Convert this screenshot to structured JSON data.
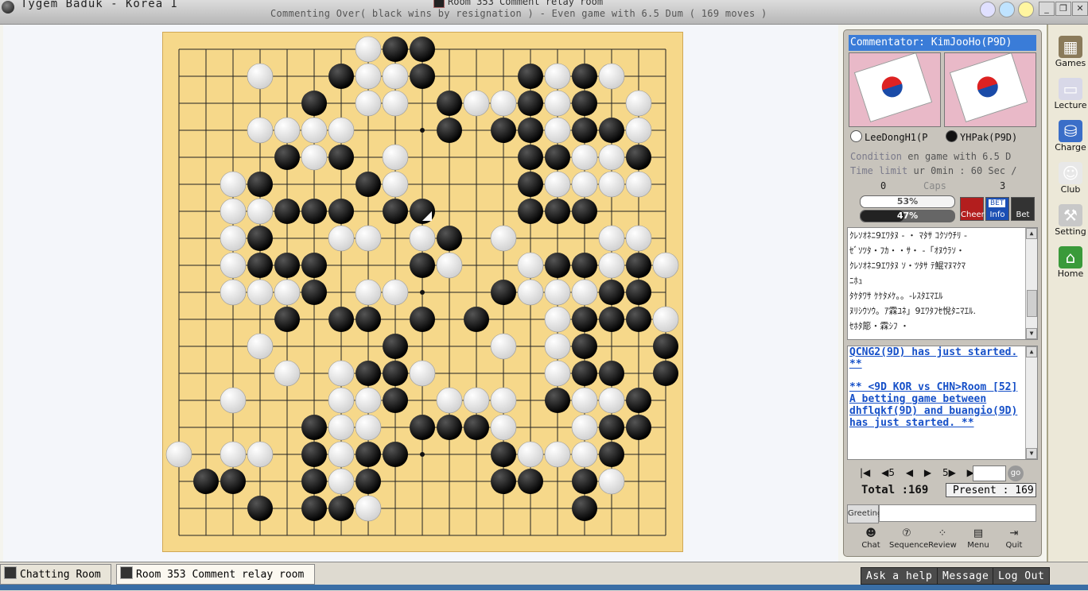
{
  "window": {
    "app_title": "Tygem Baduk - Korea I",
    "room_title": "Room 353 Comment relay room",
    "status": "Commenting Over( black wins by resignation ) - Even game with 6.5 Dum  ( 169 moves )"
  },
  "panel": {
    "commentator": "Commentator: KimJooHo(P9D)",
    "white_player": "LeeDongH1(P",
    "black_player": "YHPak(P9D)",
    "condition_label": "Condition",
    "condition_value": "en game with 6.5 D",
    "time_label": "Time limit",
    "time_value": "ur 0min : 60 Sec /",
    "caps_label": "Caps",
    "caps_white": "0",
    "caps_black": "3",
    "white_pct_label": "53%",
    "black_pct_label": "47%",
    "white_pct": 0.53,
    "black_pct": 0.47,
    "cheer_label": "Cheer",
    "info_label": "Info",
    "bet_label": "Bet",
    "info_badge": "BET",
    "chat_lines": [
      "ｸﾚｿｵﾈﾆ9ｴﾜﾀﾇ - ・ ﾏﾀｻ ｺｸｿｳﾁﾘ -",
      "ｾﾞｿﾂﾀ・ﾌｶ・・ｻ・ -「ｵﾇｳﾗｿ・",
      "ｸﾚｿｵﾈﾆ9ｴﾜﾀﾇ ｿ・ﾂﾀｻ ﾃ鯤ﾏﾇﾏｸﾏ",
      "ﾆﾎｭ",
      "ﾀｹﾀﾜｻ ｹｹﾀﾒｹ｡。-ﾚｽﾀｴﾏｴﾙ",
      "ﾇﾘｼｳｿｳ。ｱ霖ﾕﾈ」9ｴﾜﾀﾌｾ悅ﾀﾆﾏｴﾙ.",
      "ｾﾎﾀ簓・霖ｼﾌ ・"
    ],
    "notices": [
      "QCNG2(9D) has just started. **",
      "** <9D KOR vs CHN>Room [52] A betting game between dhflqkf(9D) and buangio(9D) has just started. **"
    ],
    "nav_labels": [
      "|◀",
      "◀5",
      "◀",
      "▶",
      "5▶",
      "▶|"
    ],
    "go_label": "go",
    "total_text": "Total :169",
    "present_text": "Present : 169",
    "greeting_label": "Greeting",
    "tools": [
      {
        "label": "Chat",
        "icon": "chat-icon",
        "glyph": "☻"
      },
      {
        "label": "Sequence",
        "icon": "sequence-icon",
        "glyph": "⑦"
      },
      {
        "label": "Review",
        "icon": "review-icon",
        "glyph": "⁘"
      },
      {
        "label": "Menu",
        "icon": "menu-icon",
        "glyph": "▤"
      },
      {
        "label": "Quit",
        "icon": "quit-icon",
        "glyph": "⇥"
      }
    ]
  },
  "sidebar": [
    {
      "label": "Games",
      "icon": "games-icon",
      "glyph": "▦"
    },
    {
      "label": "Lecture",
      "icon": "lecture-icon",
      "glyph": "▭"
    },
    {
      "label": "Charge",
      "icon": "charge-icon",
      "glyph": "⛁"
    },
    {
      "label": "Club",
      "icon": "club-icon",
      "glyph": "☺"
    },
    {
      "label": "Setting",
      "icon": "setting-icon",
      "glyph": "⚒"
    },
    {
      "label": "Home",
      "icon": "home-icon",
      "glyph": "⌂"
    }
  ],
  "bottom": {
    "tab_chat": "Chatting Room",
    "tab_room": "Room 353 Comment relay room",
    "ask_help": "Ask a help",
    "message": "Message",
    "logout": "Log Out"
  },
  "colors": {
    "board": "#f6d88a",
    "panel_header": "#3a7cd8",
    "notice": "#1650c8"
  },
  "board": {
    "size": 19,
    "last_move": [
      9,
      6
    ],
    "black": [
      [
        8,
        0
      ],
      [
        9,
        0
      ],
      [
        6,
        1
      ],
      [
        9,
        1
      ],
      [
        13,
        1
      ],
      [
        15,
        1
      ],
      [
        5,
        2
      ],
      [
        10,
        2
      ],
      [
        13,
        2
      ],
      [
        15,
        2
      ],
      [
        10,
        3
      ],
      [
        12,
        3
      ],
      [
        13,
        3
      ],
      [
        15,
        3
      ],
      [
        16,
        3
      ],
      [
        4,
        4
      ],
      [
        6,
        4
      ],
      [
        13,
        4
      ],
      [
        14,
        4
      ],
      [
        17,
        4
      ],
      [
        3,
        5
      ],
      [
        7,
        5
      ],
      [
        13,
        5
      ],
      [
        4,
        6
      ],
      [
        5,
        6
      ],
      [
        6,
        6
      ],
      [
        8,
        6
      ],
      [
        9,
        6
      ],
      [
        13,
        6
      ],
      [
        14,
        6
      ],
      [
        15,
        6
      ],
      [
        3,
        7
      ],
      [
        10,
        7
      ],
      [
        3,
        8
      ],
      [
        4,
        8
      ],
      [
        5,
        8
      ],
      [
        9,
        8
      ],
      [
        14,
        8
      ],
      [
        15,
        8
      ],
      [
        17,
        8
      ],
      [
        5,
        9
      ],
      [
        12,
        9
      ],
      [
        16,
        9
      ],
      [
        17,
        9
      ],
      [
        4,
        10
      ],
      [
        6,
        10
      ],
      [
        7,
        10
      ],
      [
        9,
        10
      ],
      [
        11,
        10
      ],
      [
        15,
        10
      ],
      [
        16,
        10
      ],
      [
        17,
        10
      ],
      [
        8,
        11
      ],
      [
        15,
        11
      ],
      [
        18,
        11
      ],
      [
        7,
        12
      ],
      [
        8,
        12
      ],
      [
        15,
        12
      ],
      [
        16,
        12
      ],
      [
        18,
        12
      ],
      [
        8,
        13
      ],
      [
        14,
        13
      ],
      [
        17,
        13
      ],
      [
        5,
        14
      ],
      [
        9,
        14
      ],
      [
        10,
        14
      ],
      [
        11,
        14
      ],
      [
        16,
        14
      ],
      [
        17,
        14
      ],
      [
        5,
        15
      ],
      [
        7,
        15
      ],
      [
        8,
        15
      ],
      [
        12,
        15
      ],
      [
        16,
        15
      ],
      [
        1,
        16
      ],
      [
        2,
        16
      ],
      [
        5,
        16
      ],
      [
        7,
        16
      ],
      [
        12,
        16
      ],
      [
        13,
        16
      ],
      [
        15,
        16
      ],
      [
        3,
        17
      ],
      [
        5,
        17
      ],
      [
        6,
        17
      ],
      [
        15,
        17
      ]
    ],
    "white": [
      [
        7,
        0
      ],
      [
        3,
        1
      ],
      [
        7,
        1
      ],
      [
        8,
        1
      ],
      [
        14,
        1
      ],
      [
        16,
        1
      ],
      [
        7,
        2
      ],
      [
        8,
        2
      ],
      [
        11,
        2
      ],
      [
        12,
        2
      ],
      [
        14,
        2
      ],
      [
        17,
        2
      ],
      [
        3,
        3
      ],
      [
        4,
        3
      ],
      [
        5,
        3
      ],
      [
        6,
        3
      ],
      [
        14,
        3
      ],
      [
        17,
        3
      ],
      [
        5,
        4
      ],
      [
        8,
        4
      ],
      [
        15,
        4
      ],
      [
        16,
        4
      ],
      [
        2,
        5
      ],
      [
        8,
        5
      ],
      [
        14,
        5
      ],
      [
        15,
        5
      ],
      [
        16,
        5
      ],
      [
        17,
        5
      ],
      [
        2,
        6
      ],
      [
        3,
        6
      ],
      [
        2,
        7
      ],
      [
        6,
        7
      ],
      [
        7,
        7
      ],
      [
        9,
        7
      ],
      [
        12,
        7
      ],
      [
        16,
        7
      ],
      [
        17,
        7
      ],
      [
        2,
        8
      ],
      [
        10,
        8
      ],
      [
        13,
        8
      ],
      [
        16,
        8
      ],
      [
        18,
        8
      ],
      [
        2,
        9
      ],
      [
        3,
        9
      ],
      [
        4,
        9
      ],
      [
        7,
        9
      ],
      [
        8,
        9
      ],
      [
        13,
        9
      ],
      [
        14,
        9
      ],
      [
        15,
        9
      ],
      [
        14,
        10
      ],
      [
        18,
        10
      ],
      [
        3,
        11
      ],
      [
        12,
        11
      ],
      [
        14,
        11
      ],
      [
        4,
        12
      ],
      [
        6,
        12
      ],
      [
        9,
        12
      ],
      [
        14,
        12
      ],
      [
        2,
        13
      ],
      [
        6,
        13
      ],
      [
        7,
        13
      ],
      [
        10,
        13
      ],
      [
        11,
        13
      ],
      [
        12,
        13
      ],
      [
        15,
        13
      ],
      [
        16,
        13
      ],
      [
        6,
        14
      ],
      [
        7,
        14
      ],
      [
        12,
        14
      ],
      [
        15,
        14
      ],
      [
        0,
        15
      ],
      [
        2,
        15
      ],
      [
        3,
        15
      ],
      [
        6,
        15
      ],
      [
        13,
        15
      ],
      [
        14,
        15
      ],
      [
        15,
        15
      ],
      [
        6,
        16
      ],
      [
        16,
        16
      ],
      [
        7,
        17
      ]
    ]
  }
}
